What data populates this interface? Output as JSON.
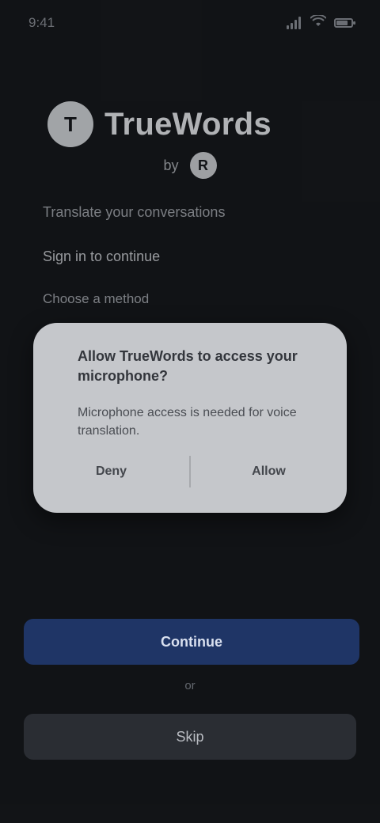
{
  "status_bar": {
    "time": "9:41",
    "battery_level": 0.8
  },
  "app": {
    "logo_letter": "T",
    "name": "TrueWords",
    "tagline_label": "by",
    "tagline_badge": "R"
  },
  "content": {
    "line1": "Translate your conversations",
    "line2": "Sign in to continue",
    "line3": "Choose a method"
  },
  "dialog": {
    "title": "Allow TrueWords to access your microphone?",
    "body": "Microphone access is needed for voice translation.",
    "deny_label": "Deny",
    "allow_label": "Allow"
  },
  "actions": {
    "primary_label": "Continue",
    "or_label": "or",
    "secondary_label": "Skip"
  }
}
